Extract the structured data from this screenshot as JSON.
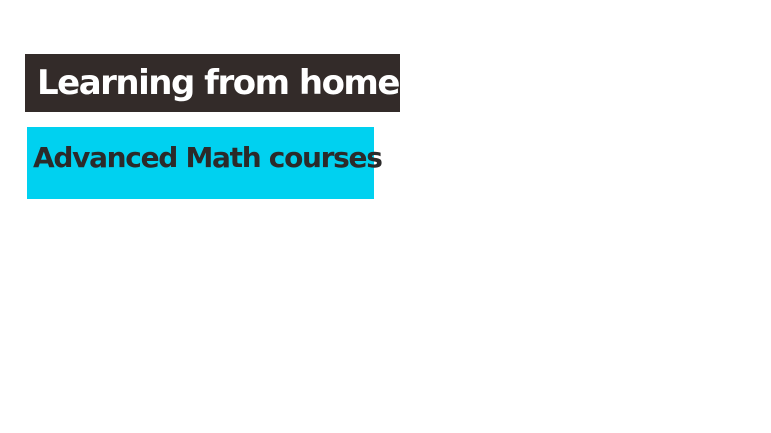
{
  "title": {
    "text": "Learning from home",
    "background": "#332b29",
    "color": "#ffffff"
  },
  "subtitle": {
    "text": "Advanced Math courses",
    "background": "#00d1f0",
    "color": "#2b2a2a"
  }
}
